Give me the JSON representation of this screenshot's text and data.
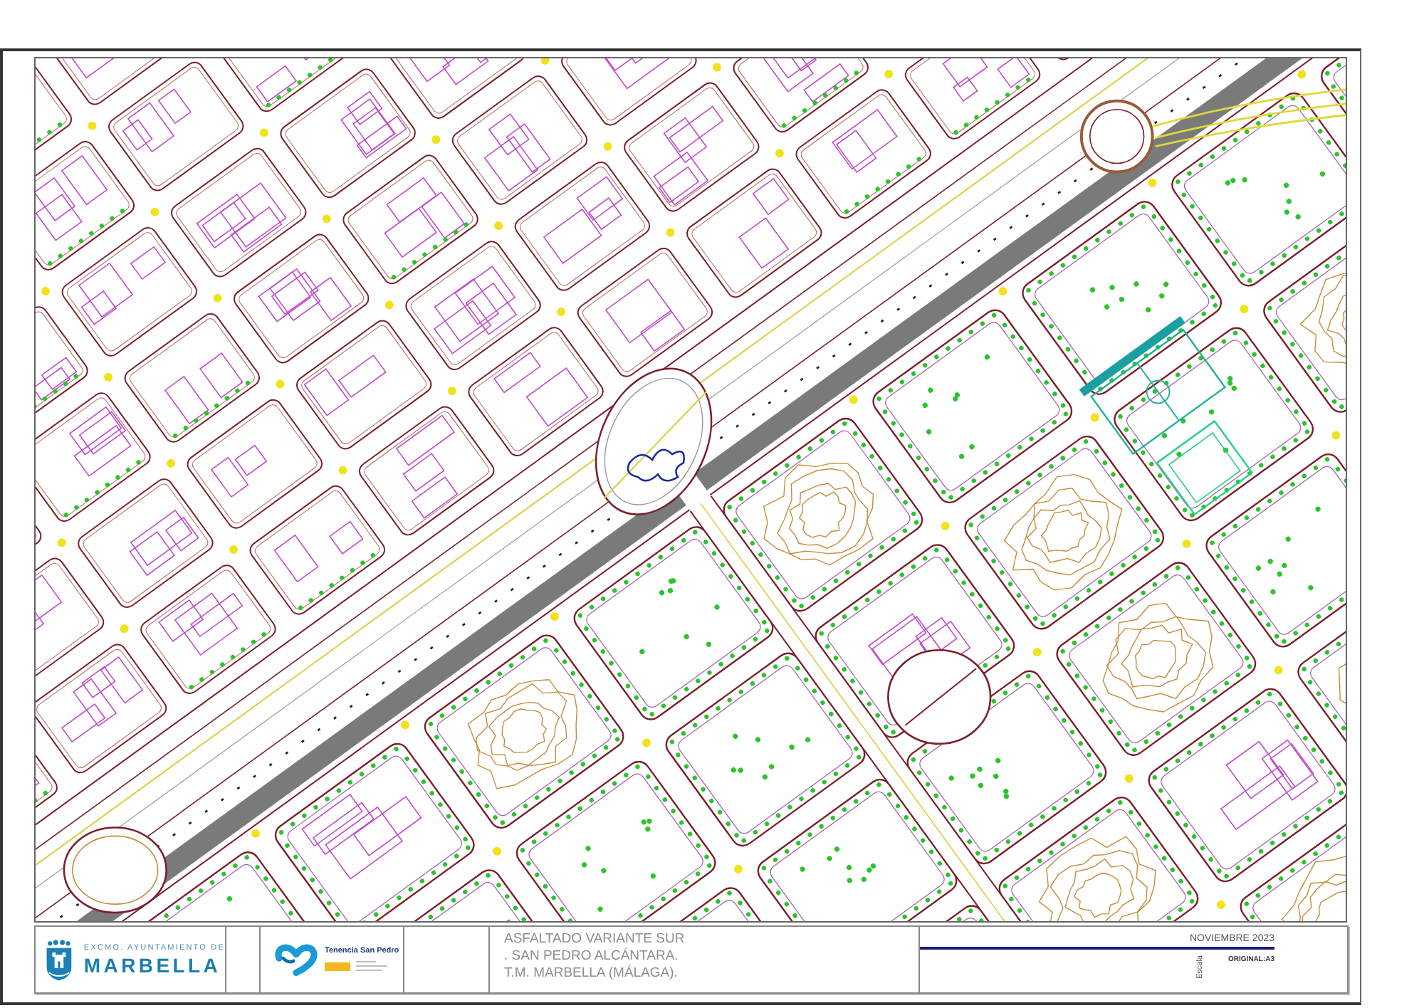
{
  "title_block": {
    "municipality": {
      "heading": "EXCMO. AYUNTAMIENTO DE",
      "name": "MARBELLA"
    },
    "district": {
      "name": "Tenencia San Pedro"
    },
    "project_lines": [
      "ASFALTADO VARIANTE SUR",
      ". SAN PEDRO ALCÁNTARA.",
      "T.M. MARBELLA (MÁLAGA)."
    ],
    "date": "NOVIEMBRE 2023",
    "scale_label": "Escala",
    "sheet_size": "ORIGINAL:A3"
  }
}
